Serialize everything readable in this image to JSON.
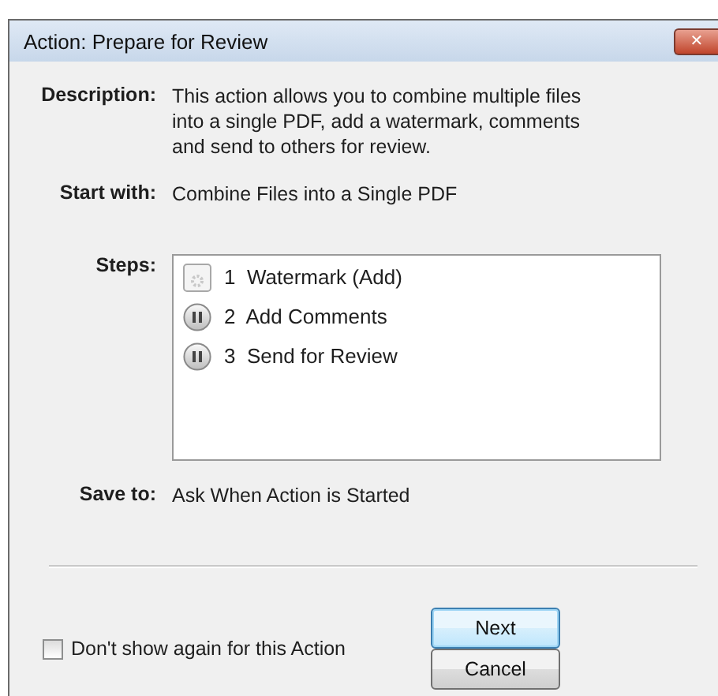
{
  "window": {
    "title": "Action: Prepare for Review",
    "close": "✕"
  },
  "fields": [
    {
      "label": "Description:",
      "value": "This action allows you to combine multiple files into a single PDF, add a watermark, comments and send to others for review."
    },
    {
      "label": "Start with:",
      "value": "Combine Files into a Single PDF"
    }
  ],
  "steps": {
    "label": "Steps:",
    "items": [
      {
        "number": "1",
        "name": "Watermark (Add)",
        "kind": "gear"
      },
      {
        "number": "2",
        "name": "Add Comments",
        "kind": "pause"
      },
      {
        "number": "3",
        "name": "Send for Review",
        "kind": "pause"
      }
    ]
  },
  "save_to": {
    "label": "Save to:",
    "value": "Ask When Action is Started"
  },
  "dont_show": {
    "label": "Don't show again for this Action",
    "checked": false
  },
  "buttons": [
    {
      "label": "Next",
      "default": true
    },
    {
      "label": "Cancel",
      "default": false
    }
  ]
}
